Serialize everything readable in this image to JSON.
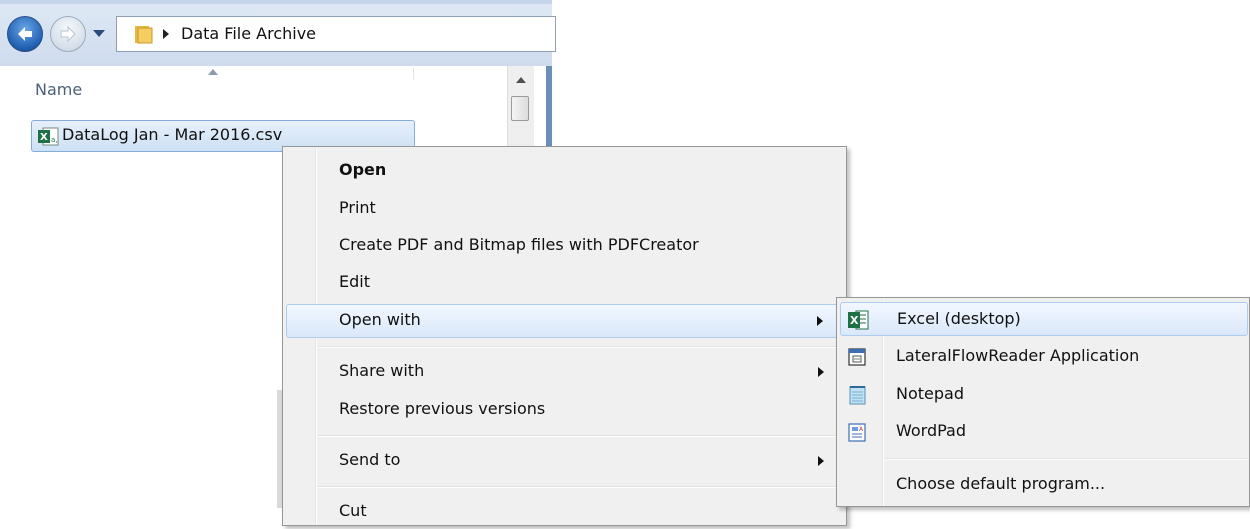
{
  "explorer": {
    "address_path": "Data File Archive",
    "column_header": "Name",
    "file": {
      "name": "DataLog Jan - Mar 2016.csv",
      "icon": "csv-excel-icon"
    }
  },
  "context_menu": {
    "items": [
      {
        "label": "Open",
        "bold": true
      },
      {
        "label": "Print"
      },
      {
        "label": "Create PDF and Bitmap files with PDFCreator"
      },
      {
        "label": "Edit"
      },
      {
        "label": "Open with",
        "submenu": true,
        "highlighted": true
      },
      {
        "label": "Share with",
        "submenu": true
      },
      {
        "label": "Restore previous versions"
      },
      {
        "label": "Send to",
        "submenu": true
      },
      {
        "label": "Cut"
      }
    ]
  },
  "open_with_submenu": {
    "items": [
      {
        "label": "Excel (desktop)",
        "icon": "excel-icon",
        "highlighted": true
      },
      {
        "label": "LateralFlowReader Application",
        "icon": "application-icon"
      },
      {
        "label": "Notepad",
        "icon": "notepad-icon"
      },
      {
        "label": "WordPad",
        "icon": "wordpad-icon"
      },
      {
        "label": "Choose default program..."
      }
    ]
  },
  "colors": {
    "highlight_border": "#aecbf0",
    "menu_background": "#f0f0f0",
    "excel_green": "#1e7145"
  }
}
